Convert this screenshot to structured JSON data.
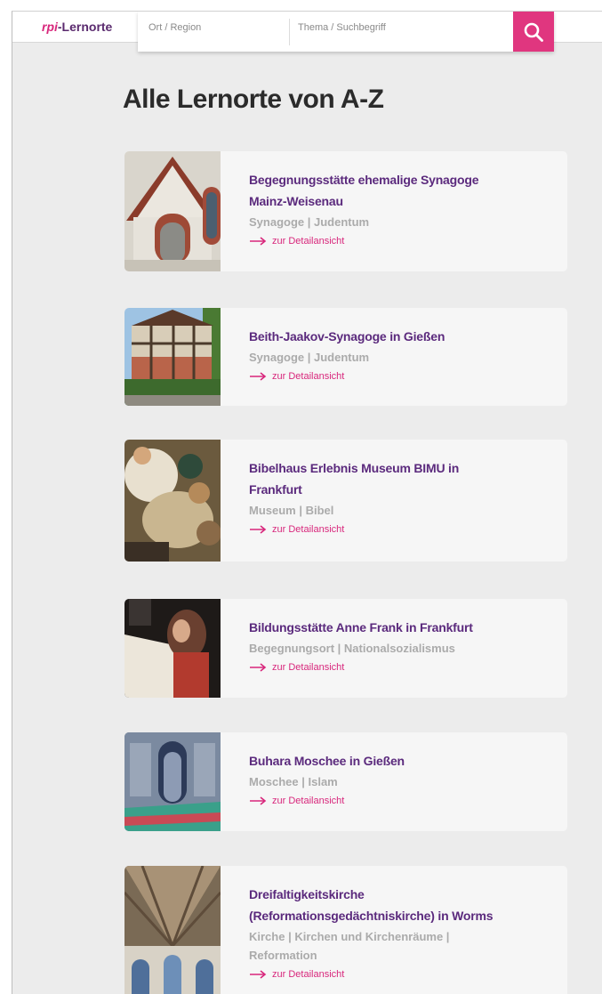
{
  "header": {
    "logo_prefix": "rpi",
    "logo_suffix": "-Lernorte",
    "region_placeholder": "Ort / Region",
    "topic_placeholder": "Thema / Suchbegriff",
    "search_icon": "search-icon"
  },
  "colors": {
    "accent": "#e0367f",
    "title": "#5b2a7d",
    "tags": "#ababab",
    "background": "#ececec"
  },
  "page_title": "Alle Lernorte von A-Z",
  "detail_label": "zur Detailansicht",
  "entries": [
    {
      "title_lines": [
        "Begegnungsstätte ehemalige Synagoge",
        "Mainz-Weisenau"
      ],
      "tag_lines": [
        "Synagoge | Judentum"
      ],
      "image": "synagogue-facade"
    },
    {
      "title_lines": [
        "Beith-Jaakov-Synagoge in Gießen"
      ],
      "tag_lines": [
        "Synagoge | Judentum"
      ],
      "image": "half-timbered-synagogue"
    },
    {
      "title_lines": [
        "Bibelhaus Erlebnis Museum BIMU in",
        "Frankfurt"
      ],
      "tag_lines": [
        "Museum | Bibel"
      ],
      "image": "children-with-artifacts"
    },
    {
      "title_lines": [
        "Bildungsstätte Anne Frank in Frankfurt"
      ],
      "tag_lines": [
        "Begegnungsort | Nationalsozialismus"
      ],
      "image": "girl-at-table"
    },
    {
      "title_lines": [
        "Buhara Moschee in Gießen"
      ],
      "tag_lines": [
        "Moschee | Islam"
      ],
      "image": "mosque-interior"
    },
    {
      "title_lines": [
        "Dreifaltigkeitskirche",
        "(Reformationsgedächtniskirche) in Worms"
      ],
      "tag_lines": [
        "Kirche | Kirchen und Kirchenräume |",
        "Reformation"
      ],
      "image": "church-vault"
    }
  ]
}
